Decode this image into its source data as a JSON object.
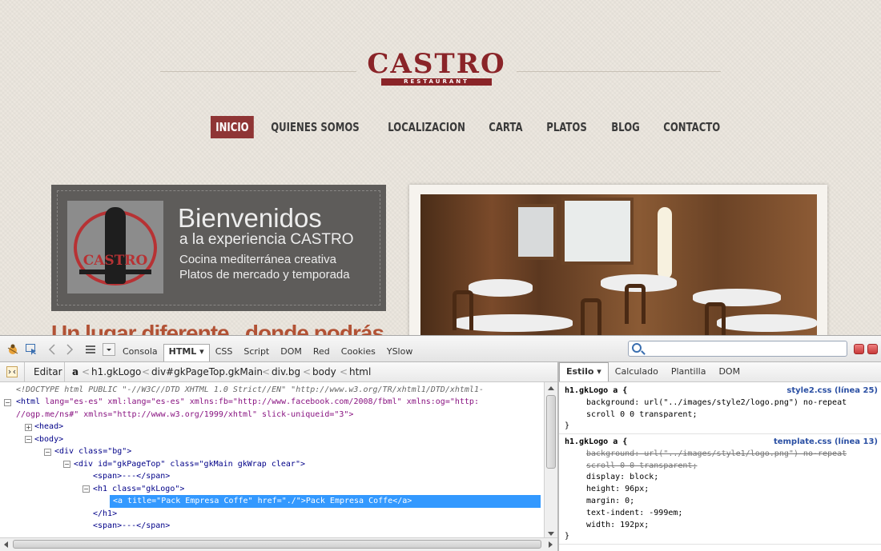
{
  "site": {
    "logo_text": "CASTRO",
    "logo_sub": "RESTAURANT",
    "nav": [
      "INICIO",
      "QUIENES SOMOS",
      "LOCALIZACION",
      "CARTA",
      "PLATOS",
      "BLOG",
      "CONTACTO"
    ],
    "nav_active": "INICIO",
    "welcome": {
      "logo_text": "CASTRO",
      "title": "Bienvenidos",
      "subtitle": "a la experiencia CASTRO",
      "line1": "Cocina mediterránea creativa",
      "line2": "Platos de mercado y temporada"
    },
    "slogan": "Un lugar diferente , donde podrás",
    "colors": {
      "brand": "#8a2428",
      "nav_active": "#8f3535",
      "welcome_bg": "#5e5c5a",
      "slogan": "#b25235"
    }
  },
  "firebug": {
    "tabs": [
      "Consola",
      "HTML",
      "CSS",
      "Script",
      "DOM",
      "Red",
      "Cookies",
      "YSlow"
    ],
    "selected_tab": "HTML",
    "search_placeholder": "",
    "edit_label": "Editar",
    "breadcrumb": [
      "a",
      "h1.gkLogo",
      "div#gkPageTop.gkMain",
      "div.bg",
      "body",
      "html"
    ],
    "side_tabs": [
      "Estilo",
      "Calculado",
      "Plantilla",
      "DOM"
    ],
    "side_selected": "Estilo",
    "html_lines": {
      "doctype": "<!DOCTYPE html PUBLIC \"-//W3C//DTD XHTML 1.0 Strict//EN\" \"http://www.w3.org/TR/xhtml1/DTD/xhtml1-",
      "html_open_a": "<html",
      "html_attrs1": " lang=\"es-es\" xml:lang=\"es-es\" xmlns:fb=\"http://www.facebook.com/2008/fbml\" xmlns:og=\"http:",
      "html_attrs2": "//ogp.me/ns#\" xmlns=\"http://www.w3.org/1999/xhtml\" slick-uniqueid=\"3\">",
      "head": "<head>",
      "body": "<body>",
      "div_bg": "<div class=\"bg\">",
      "div_top": "<div id=\"gkPageTop\" class=\"gkMain gkWrap clear\">",
      "span1": "<span>---</span>",
      "h1": "<h1 class=\"gkLogo\">",
      "a_sel": "<a title=\"Pack Empresa Coffe\" href=\"./\">Pack Empresa Coffe</a>",
      "h1_close": "</h1>",
      "span2": "<span>---</span>"
    },
    "css_rules": [
      {
        "selector": "h1.gkLogo a {",
        "source": "style2.css (línea 25)",
        "props": [
          {
            "text": "background: url(\"../images/style2/logo.png\") no-repeat",
            "strike": false
          },
          {
            "text": " scroll 0 0 transparent;",
            "strike": false
          }
        ],
        "close": "}"
      },
      {
        "selector": "h1.gkLogo a {",
        "source": "template.css (línea 13)",
        "props": [
          {
            "text": "background: url(\"../images/style1/logo.png\") no-repeat",
            "strike": true
          },
          {
            "text": " scroll 0 0 transparent;",
            "strike": true
          },
          {
            "text": "display: block;",
            "strike": false
          },
          {
            "text": "height: 96px;",
            "strike": false
          },
          {
            "text": "margin: 0;",
            "strike": false
          },
          {
            "text": "text-indent: -999em;",
            "strike": false
          },
          {
            "text": "width: 192px;",
            "strike": false
          }
        ],
        "close": "}"
      }
    ]
  }
}
